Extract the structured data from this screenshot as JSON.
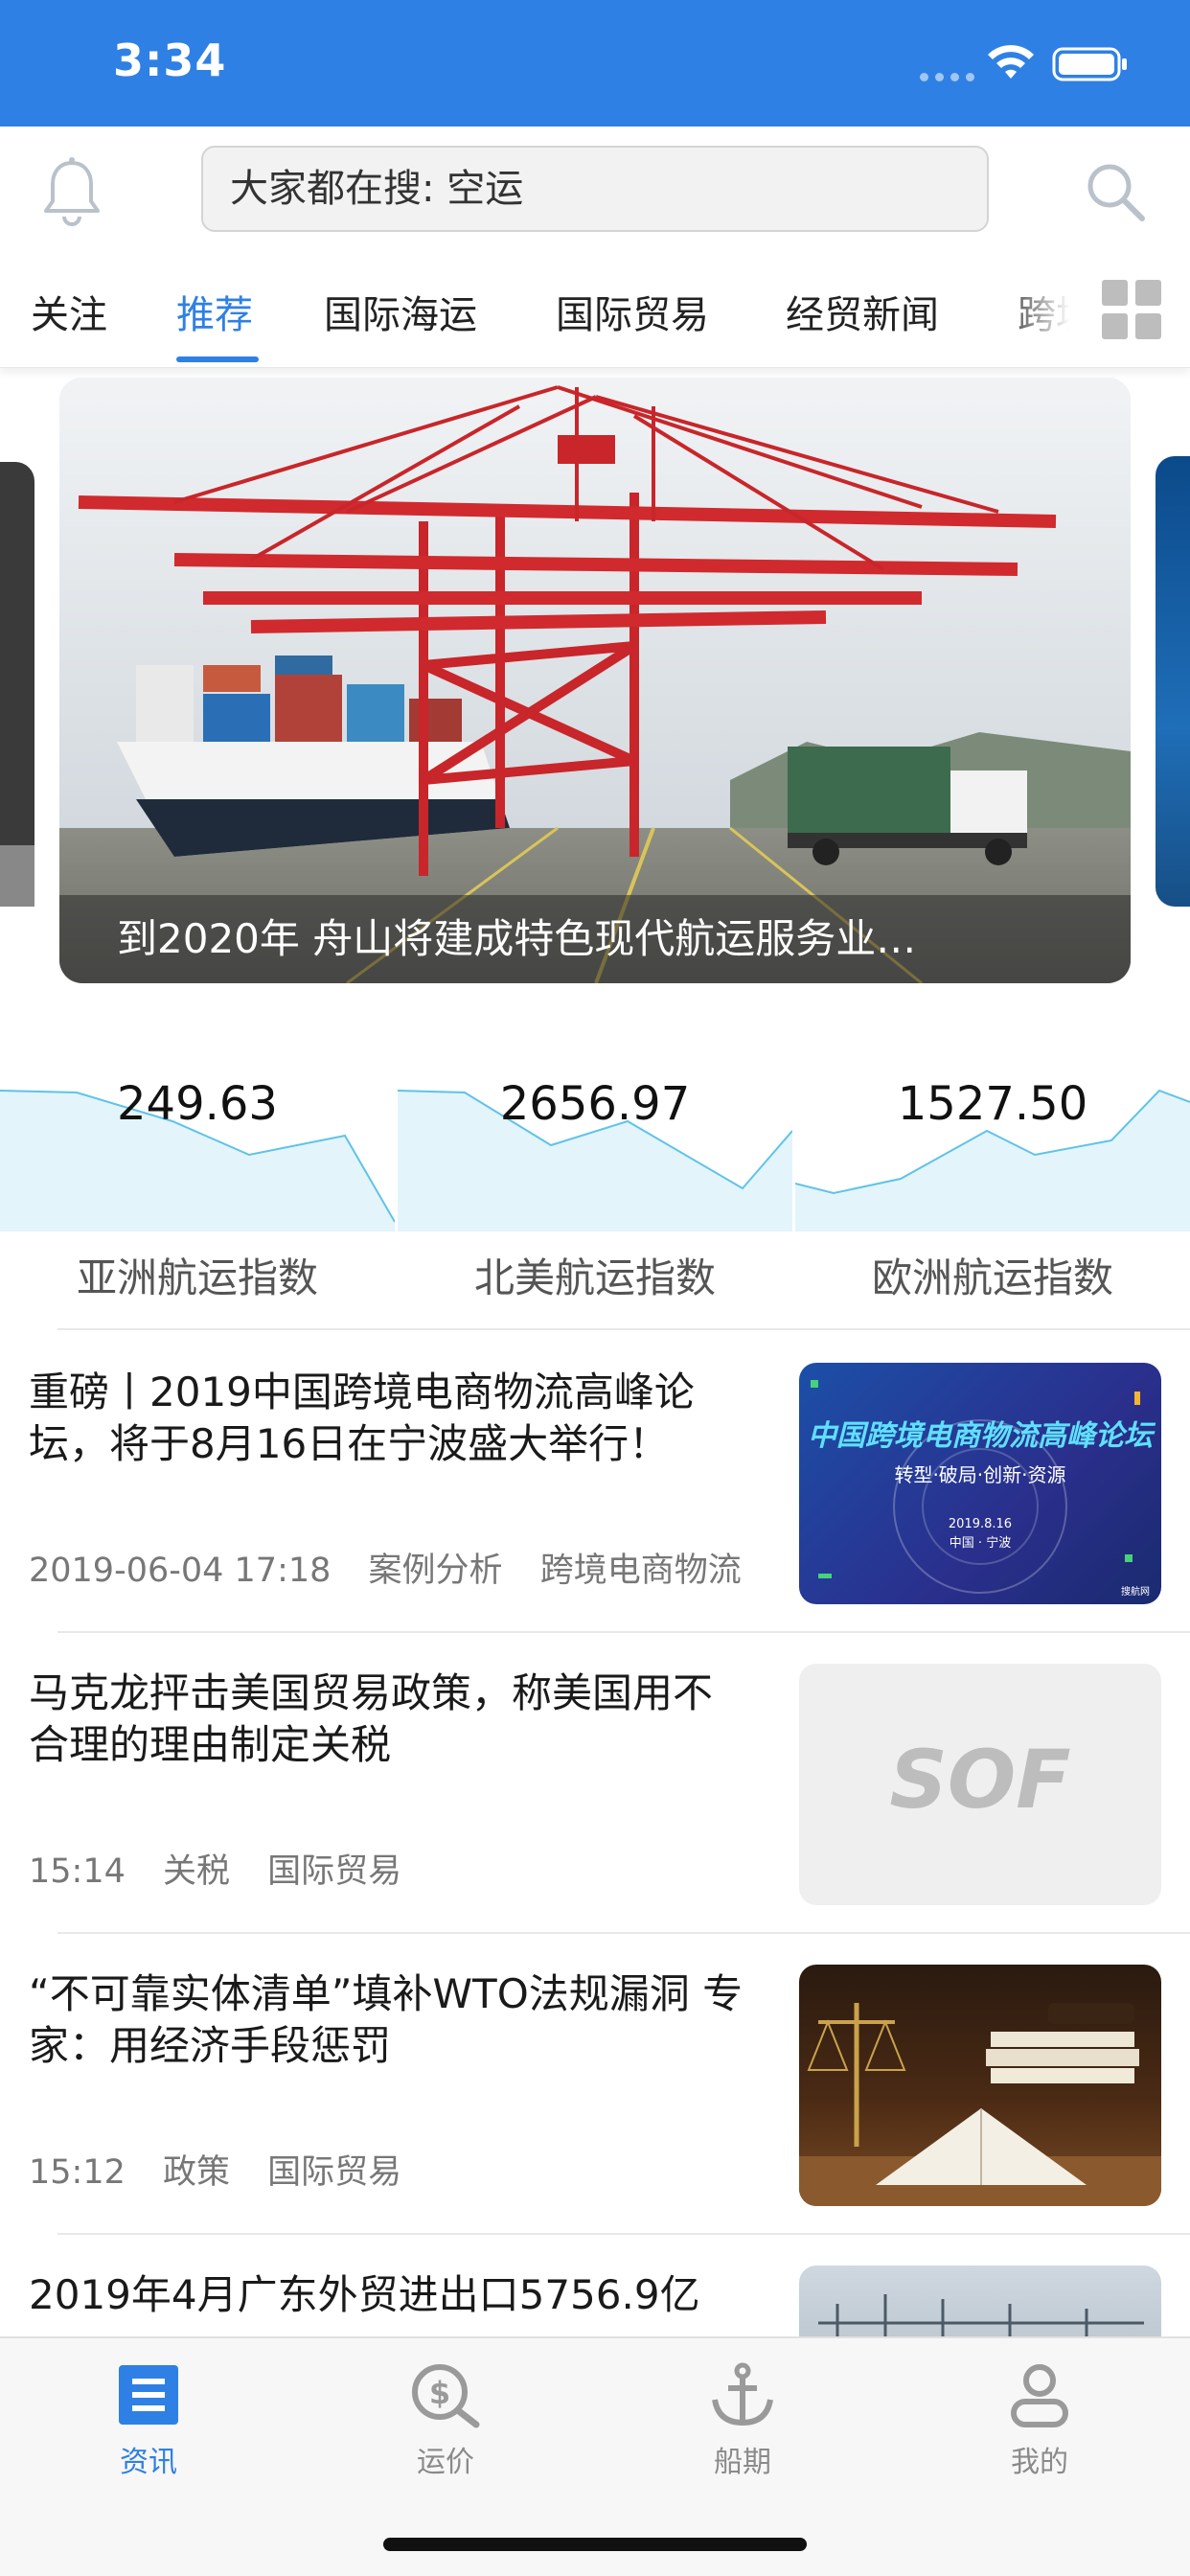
{
  "status_bar": {
    "time": "3:34"
  },
  "header": {
    "search_placeholder": "大家都在搜: 空运"
  },
  "tabs": [
    {
      "label": "关注",
      "active": false
    },
    {
      "label": "推荐",
      "active": true
    },
    {
      "label": "国际海运",
      "active": false
    },
    {
      "label": "国际贸易",
      "active": false
    },
    {
      "label": "经贸新闻",
      "active": false
    },
    {
      "label": "跨境",
      "active": false
    }
  ],
  "banner": {
    "caption": "到2020年 舟山将建成特色现代航运服务业…"
  },
  "indexes": [
    {
      "value": "249.63",
      "label": "亚洲航运指数"
    },
    {
      "value": "2656.97",
      "label": "北美航运指数"
    },
    {
      "value": "1527.50",
      "label": "欧洲航运指数"
    }
  ],
  "news": [
    {
      "title": "重磅丨2019中国跨境电商物流高峰论坛，将于8月16日在宁波盛大举行！",
      "time": "2019-06-04 17:18",
      "tags": [
        "案例分析",
        "跨境电商物流"
      ],
      "thumb": {
        "title": "中国跨境电商物流高峰论坛",
        "subtitle": "转型·破局·创新·资源",
        "date": "2019.8.16",
        "place": "中国 · 宁波",
        "source": "搜航网"
      }
    },
    {
      "title": "马克龙抨击美国贸易政策，称美国用不合理的理由制定关税",
      "time": "15:14",
      "tags": [
        "关税",
        "国际贸易"
      ],
      "thumb": {
        "logo": "SOF"
      }
    },
    {
      "title": "“不可靠实体清单”填补WTO法规漏洞 专家：用经济手段惩罚",
      "time": "15:12",
      "tags": [
        "政策",
        "国际贸易"
      ]
    },
    {
      "title": "2019年4月广东外贸进出口5756.9亿",
      "time": "",
      "tags": []
    }
  ],
  "bottom_nav": [
    {
      "label": "资讯",
      "icon": "news-icon",
      "active": true
    },
    {
      "label": "运价",
      "icon": "price-icon",
      "active": false
    },
    {
      "label": "船期",
      "icon": "anchor-icon",
      "active": false
    },
    {
      "label": "我的",
      "icon": "profile-icon",
      "active": false
    }
  ],
  "colors": {
    "accent": "#2f80e4",
    "chart_line": "#5fc3e8",
    "chart_fill": "#e3f4fb"
  }
}
